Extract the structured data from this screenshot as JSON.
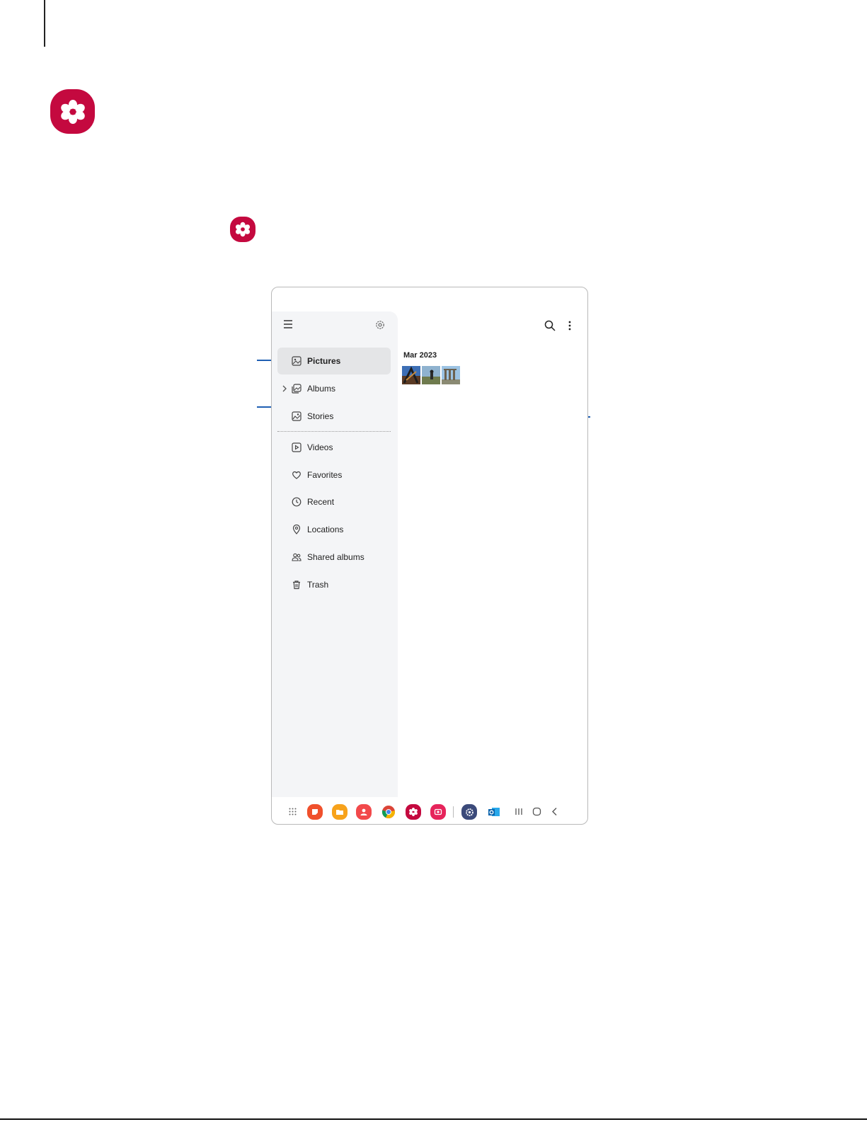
{
  "colors": {
    "gallery_brand": "#c4093f",
    "callout_line": "#1f5fb3",
    "drawer_background": "#f4f5f7",
    "selected_item": "#e4e5e7"
  },
  "app_icon": "gallery-flower-icon",
  "toolbar": {
    "menu_icon": "hamburger-icon",
    "settings_icon": "gear-icon",
    "search_icon": "search-icon",
    "more_icon": "more-vertical-icon"
  },
  "drawer": {
    "items": [
      {
        "label": "Pictures",
        "icon": "image-icon",
        "selected": true
      },
      {
        "label": "Albums",
        "icon": "albums-icon",
        "expandable": true
      },
      {
        "label": "Stories",
        "icon": "stories-icon"
      },
      {
        "label": "Videos",
        "icon": "video-icon"
      },
      {
        "label": "Favorites",
        "icon": "heart-icon"
      },
      {
        "label": "Recent",
        "icon": "clock-icon"
      },
      {
        "label": "Locations",
        "icon": "location-pin-icon"
      },
      {
        "label": "Shared albums",
        "icon": "people-icon"
      },
      {
        "label": "Trash",
        "icon": "trash-icon"
      }
    ]
  },
  "content": {
    "date_header": "Mar 2023",
    "thumbnails": [
      "photo-1",
      "photo-2",
      "photo-3"
    ]
  },
  "taskbar": {
    "apps": [
      "apps-grid-icon",
      "notes-icon",
      "my-files-icon",
      "contacts-icon",
      "chrome-icon",
      "gallery-icon",
      "screen-recorder-icon",
      "settings-app-icon",
      "outlook-icon"
    ],
    "nav": [
      "recents-icon",
      "home-icon",
      "back-icon"
    ]
  }
}
